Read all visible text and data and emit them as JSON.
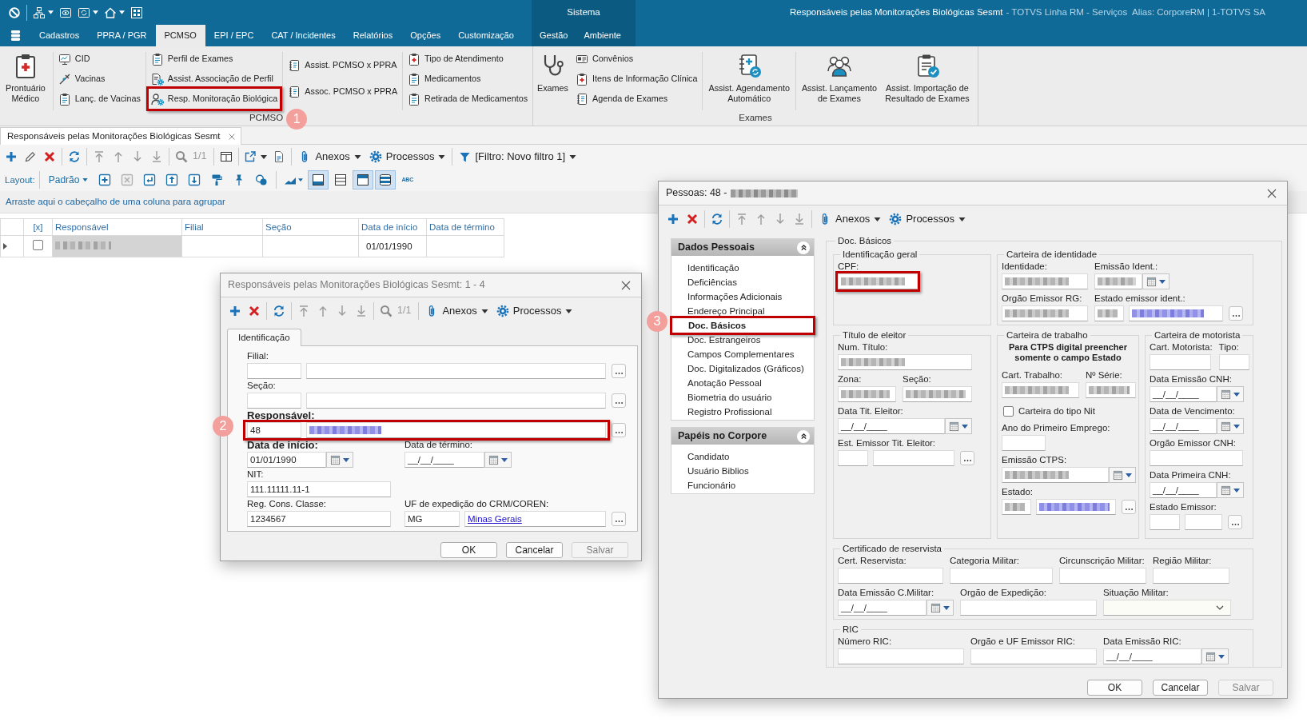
{
  "header": {
    "context_label": "Sistema",
    "title": "Responsáveis pelas Monitorações Biológicas Sesmt",
    "title_suffix": "- TOTVS Linha RM - Serviços  Alias: CorporeRM | 1-TOTVS SA"
  },
  "menu_tabs": [
    {
      "label": "Cadastros",
      "selected": false
    },
    {
      "label": "PPRA / PGR",
      "selected": false
    },
    {
      "label": "PCMSO",
      "selected": true
    },
    {
      "label": "EPI / EPC",
      "selected": false
    },
    {
      "label": "CAT / Incidentes",
      "selected": false
    },
    {
      "label": "Relatórios",
      "selected": false
    },
    {
      "label": "Opções",
      "selected": false
    },
    {
      "label": "Customização",
      "selected": false
    }
  ],
  "context_tabs": [
    {
      "label": "Gestão",
      "selected": false
    },
    {
      "label": "Ambiente",
      "selected": false
    }
  ],
  "ribbon": [
    {
      "label": "PCMSO",
      "sections": [
        {
          "kind": "large",
          "label": "Prontuário\nMédico"
        },
        {
          "kind": "separator"
        },
        {
          "kind": "column",
          "items": [
            {
              "label": "CID"
            },
            {
              "label": "Vacinas"
            },
            {
              "label": "Lanç. de Vacinas"
            }
          ]
        },
        {
          "kind": "separator"
        },
        {
          "kind": "column",
          "items": [
            {
              "label": "Perfil de Exames",
              "highlighted": false
            },
            {
              "label": "Assist. Associação de Perfil",
              "highlighted": false
            },
            {
              "label": "Resp. Monitoração Biológica",
              "highlighted": true,
              "callout": "1"
            }
          ]
        },
        {
          "kind": "separator"
        },
        {
          "kind": "column",
          "items": [
            {
              "label": "Assist. PCMSO x PPRA"
            },
            {
              "label": "Assoc. PCMSO x PPRA"
            }
          ]
        },
        {
          "kind": "separator"
        },
        {
          "kind": "column",
          "items": [
            {
              "label": "Tipo de Atendimento"
            },
            {
              "label": "Medicamentos"
            },
            {
              "label": "Retirada de Medicamentos"
            }
          ]
        }
      ]
    },
    {
      "label": "Exames",
      "sections": [
        {
          "kind": "large",
          "label": "Exames"
        },
        {
          "kind": "column",
          "items": [
            {
              "label": "Convênios"
            },
            {
              "label": "Itens de Informação Clínica"
            },
            {
              "label": "Agenda de Exames"
            }
          ]
        },
        {
          "kind": "separator"
        },
        {
          "kind": "large",
          "label": "Assist. Agendamento\nAutomático"
        },
        {
          "kind": "separator"
        },
        {
          "kind": "large",
          "label": "Assist. Lançamento\nde Exames"
        },
        {
          "kind": "large",
          "label": "Assist. Importação de\nResultado de Exames"
        }
      ]
    }
  ],
  "document_tab": {
    "label": "Responsáveis pelas Monitorações Biológicas Sesmt",
    "selected": true
  },
  "main_toolbar": {
    "navigation_disabled": true,
    "record_position": "1/1",
    "menus": [
      "Anexos",
      "Processos"
    ],
    "filter": "[Filtro: Novo filtro 1]"
  },
  "layout_bar": {
    "label": "Layout:",
    "preset": "Padrão",
    "remove_disabled": true,
    "toggles": [
      {
        "selected": true
      },
      {
        "selected": false
      },
      {
        "selected": true
      },
      {
        "selected": true
      }
    ],
    "spell_label": "ABC"
  },
  "group_panel": {
    "hint": "Arraste aqui o cabeçalho de uma coluna para agrupar"
  },
  "grid": {
    "columns": [
      "[x]",
      "Responsável",
      "Filial",
      "Seção",
      "Data de início",
      "Data de término"
    ],
    "rows": [
      {
        "current": true,
        "checked": false,
        "responsible": {
          "redacted": true,
          "focused": true
        },
        "start_date": "01/01/1990"
      }
    ]
  },
  "responsible_dialog": {
    "title": "Responsáveis pelas Monitorações Biológicas Sesmt: 1 - 4",
    "active": false,
    "toolbar": {
      "navigation_disabled": true,
      "record_position": "1/1",
      "menus": [
        "Anexos",
        "Processos"
      ]
    },
    "tabs": [
      {
        "label": "Identificação",
        "selected": true
      }
    ],
    "rows": [
      [
        {
          "kind": "lookup",
          "label": "Filial:",
          "required": false,
          "highlighted": false
        }
      ],
      [
        {
          "kind": "lookup",
          "label": "Seção:",
          "required": false,
          "highlighted": false
        }
      ],
      [
        {
          "kind": "lookup",
          "label": "Responsável:",
          "required": true,
          "code": "48",
          "description_redacted": true,
          "highlighted": true,
          "callout": "2"
        }
      ],
      [
        {
          "kind": "date",
          "label": "Data de início:",
          "required": true,
          "value": "01/01/1990",
          "highlighted": false
        },
        {
          "kind": "date",
          "label": "Data de término:",
          "required": false,
          "value": "__/__/____",
          "highlighted": false
        }
      ],
      [
        {
          "kind": "text",
          "label": "NIT:",
          "required": false,
          "value": "111.11111.11-1",
          "highlighted": false
        }
      ],
      [
        {
          "kind": "text",
          "label": "Reg. Cons. Classe:",
          "required": false,
          "value": "1234567",
          "highlighted": false
        },
        {
          "kind": "lookup",
          "label": "UF de expedição do CRM/COREN:",
          "required": false,
          "code": "MG",
          "description": "Minas Gerais",
          "highlighted": false
        }
      ]
    ],
    "buttons": [
      {
        "label": "OK",
        "disabled": false
      },
      {
        "label": "Cancelar",
        "disabled": false
      },
      {
        "label": "Salvar",
        "disabled": true
      }
    ]
  },
  "person_dialog": {
    "title": "Pessoas: 48 -",
    "title_redacted": true,
    "active": true,
    "toolbar": {
      "navigation_disabled": true,
      "menus": [
        "Anexos",
        "Processos"
      ]
    },
    "sidebar": [
      {
        "label": "Dados Pessoais",
        "expanded": true,
        "items": [
          {
            "label": "Identificação",
            "selected": false,
            "highlighted": false
          },
          {
            "label": "Deficiências",
            "selected": false,
            "highlighted": false
          },
          {
            "label": "Informações Adicionais",
            "selected": false,
            "highlighted": false
          },
          {
            "label": "Endereço Principal",
            "selected": false,
            "highlighted": false
          },
          {
            "label": "Doc. Básicos",
            "selected": true,
            "highlighted": true,
            "callout": "3"
          },
          {
            "label": "Doc. Estrangeiros",
            "selected": false,
            "highlighted": false
          },
          {
            "label": "Campos Complementares",
            "selected": false,
            "highlighted": false
          },
          {
            "label": "Doc. Digitalizados (Gráficos)",
            "selected": false,
            "highlighted": false
          },
          {
            "label": "Anotação Pessoal",
            "selected": false,
            "highlighted": false
          },
          {
            "label": "Biometria do usuário",
            "selected": false,
            "highlighted": false
          },
          {
            "label": "Registro Profissional",
            "selected": false,
            "highlighted": false
          }
        ]
      },
      {
        "label": "Papéis no Corpore",
        "expanded": true,
        "items": [
          {
            "label": "Candidato",
            "selected": false,
            "highlighted": false
          },
          {
            "label": "Usuário Biblios",
            "selected": false,
            "highlighted": false
          },
          {
            "label": "Funcionário",
            "selected": false,
            "highlighted": false
          }
        ]
      }
    ],
    "section_title": "Doc. Básicos",
    "groups": [
      {
        "title": "Identificação geral",
        "rows": [
          [
            {
              "kind": "text",
              "label": "CPF:",
              "redacted": true,
              "highlighted": true
            }
          ]
        ]
      },
      {
        "title": "Carteira de identidade",
        "rows": [
          [
            {
              "kind": "text",
              "label": "Identidade:",
              "redacted": true
            },
            {
              "kind": "date",
              "label": "Emissão Ident.:",
              "redacted": true
            }
          ],
          [
            {
              "kind": "text",
              "label": "Orgão Emissor RG:",
              "redacted": true
            },
            {
              "kind": "lookup",
              "label": "Estado emissor ident.:",
              "code_redacted": true,
              "description_redacted": true
            }
          ]
        ]
      },
      {
        "title": "Título de eleitor",
        "rows": [
          [
            {
              "kind": "text",
              "label": "Num. Título:",
              "redacted": true
            }
          ],
          [
            {
              "kind": "text",
              "label": "Zona:",
              "redacted": true
            },
            {
              "kind": "text",
              "label": "Seção:",
              "redacted": true
            }
          ],
          [
            {
              "kind": "date",
              "label": "Data Tit. Eleitor:",
              "value": "__/__/____"
            }
          ],
          [
            {
              "kind": "lookup",
              "label": "Est. Emissor Tit. Eleitor:"
            }
          ]
        ]
      },
      {
        "title": "Carteira de trabalho",
        "rows": [
          [
            {
              "kind": "note",
              "text": "Para CTPS digital preencher\nsomente o campo Estado"
            }
          ],
          [
            {
              "kind": "text",
              "label": "Cart. Trabalho:",
              "redacted": true
            },
            {
              "kind": "text",
              "label": "Nº Série:",
              "redacted": true
            }
          ],
          [
            {
              "kind": "checkbox",
              "label": "Carteira do tipo Nit",
              "checked": false
            }
          ],
          [
            {
              "kind": "text",
              "label": "Ano do Primeiro Emprego:"
            }
          ],
          [
            {
              "kind": "date",
              "label": "Emissão CTPS:",
              "redacted": true
            }
          ],
          [
            {
              "kind": "lookup",
              "label": "Estado:",
              "code_redacted": true,
              "description_redacted": true
            }
          ]
        ]
      },
      {
        "title": "Carteira de motorista",
        "rows": [
          [
            {
              "kind": "text",
              "label": "Cart. Motorista:"
            },
            {
              "kind": "text",
              "label": "Tipo:"
            }
          ],
          [
            {
              "kind": "date",
              "label": "Data Emissão CNH:",
              "value": "__/__/____"
            }
          ],
          [
            {
              "kind": "date",
              "label": "Data de Vencimento:",
              "value": "__/__/____"
            }
          ],
          [
            {
              "kind": "text",
              "label": "Orgão Emissor CNH:"
            }
          ],
          [
            {
              "kind": "date",
              "label": "Data Primeira CNH:",
              "value": "__/__/____"
            }
          ],
          [
            {
              "kind": "lookup",
              "label": "Estado Emissor:"
            }
          ]
        ]
      },
      {
        "title": "Certificado de reservista",
        "rows": [
          [
            {
              "kind": "text",
              "label": "Cert. Reservista:"
            },
            {
              "kind": "text",
              "label": "Categoria Militar:"
            },
            {
              "kind": "text",
              "label": "Circunscrição Militar:"
            },
            {
              "kind": "text",
              "label": "Região Militar:"
            }
          ],
          [
            {
              "kind": "date",
              "label": "Data Emissão C.Militar:",
              "value": "__/__/____"
            },
            {
              "kind": "text",
              "label": "Orgão de Expedição:"
            },
            {
              "kind": "select",
              "label": "Situação Militar:"
            }
          ]
        ]
      },
      {
        "title": "RIC",
        "rows": [
          [
            {
              "kind": "text",
              "label": "Número RIC:"
            },
            {
              "kind": "text",
              "label": "Orgão e UF Emissor RIC:"
            },
            {
              "kind": "date",
              "label": "Data Emissão RIC:",
              "value": "__/__/____"
            }
          ]
        ]
      }
    ],
    "buttons": [
      {
        "label": "OK",
        "disabled": false
      },
      {
        "label": "Cancelar",
        "disabled": false
      },
      {
        "label": "Salvar",
        "disabled": true
      }
    ]
  }
}
